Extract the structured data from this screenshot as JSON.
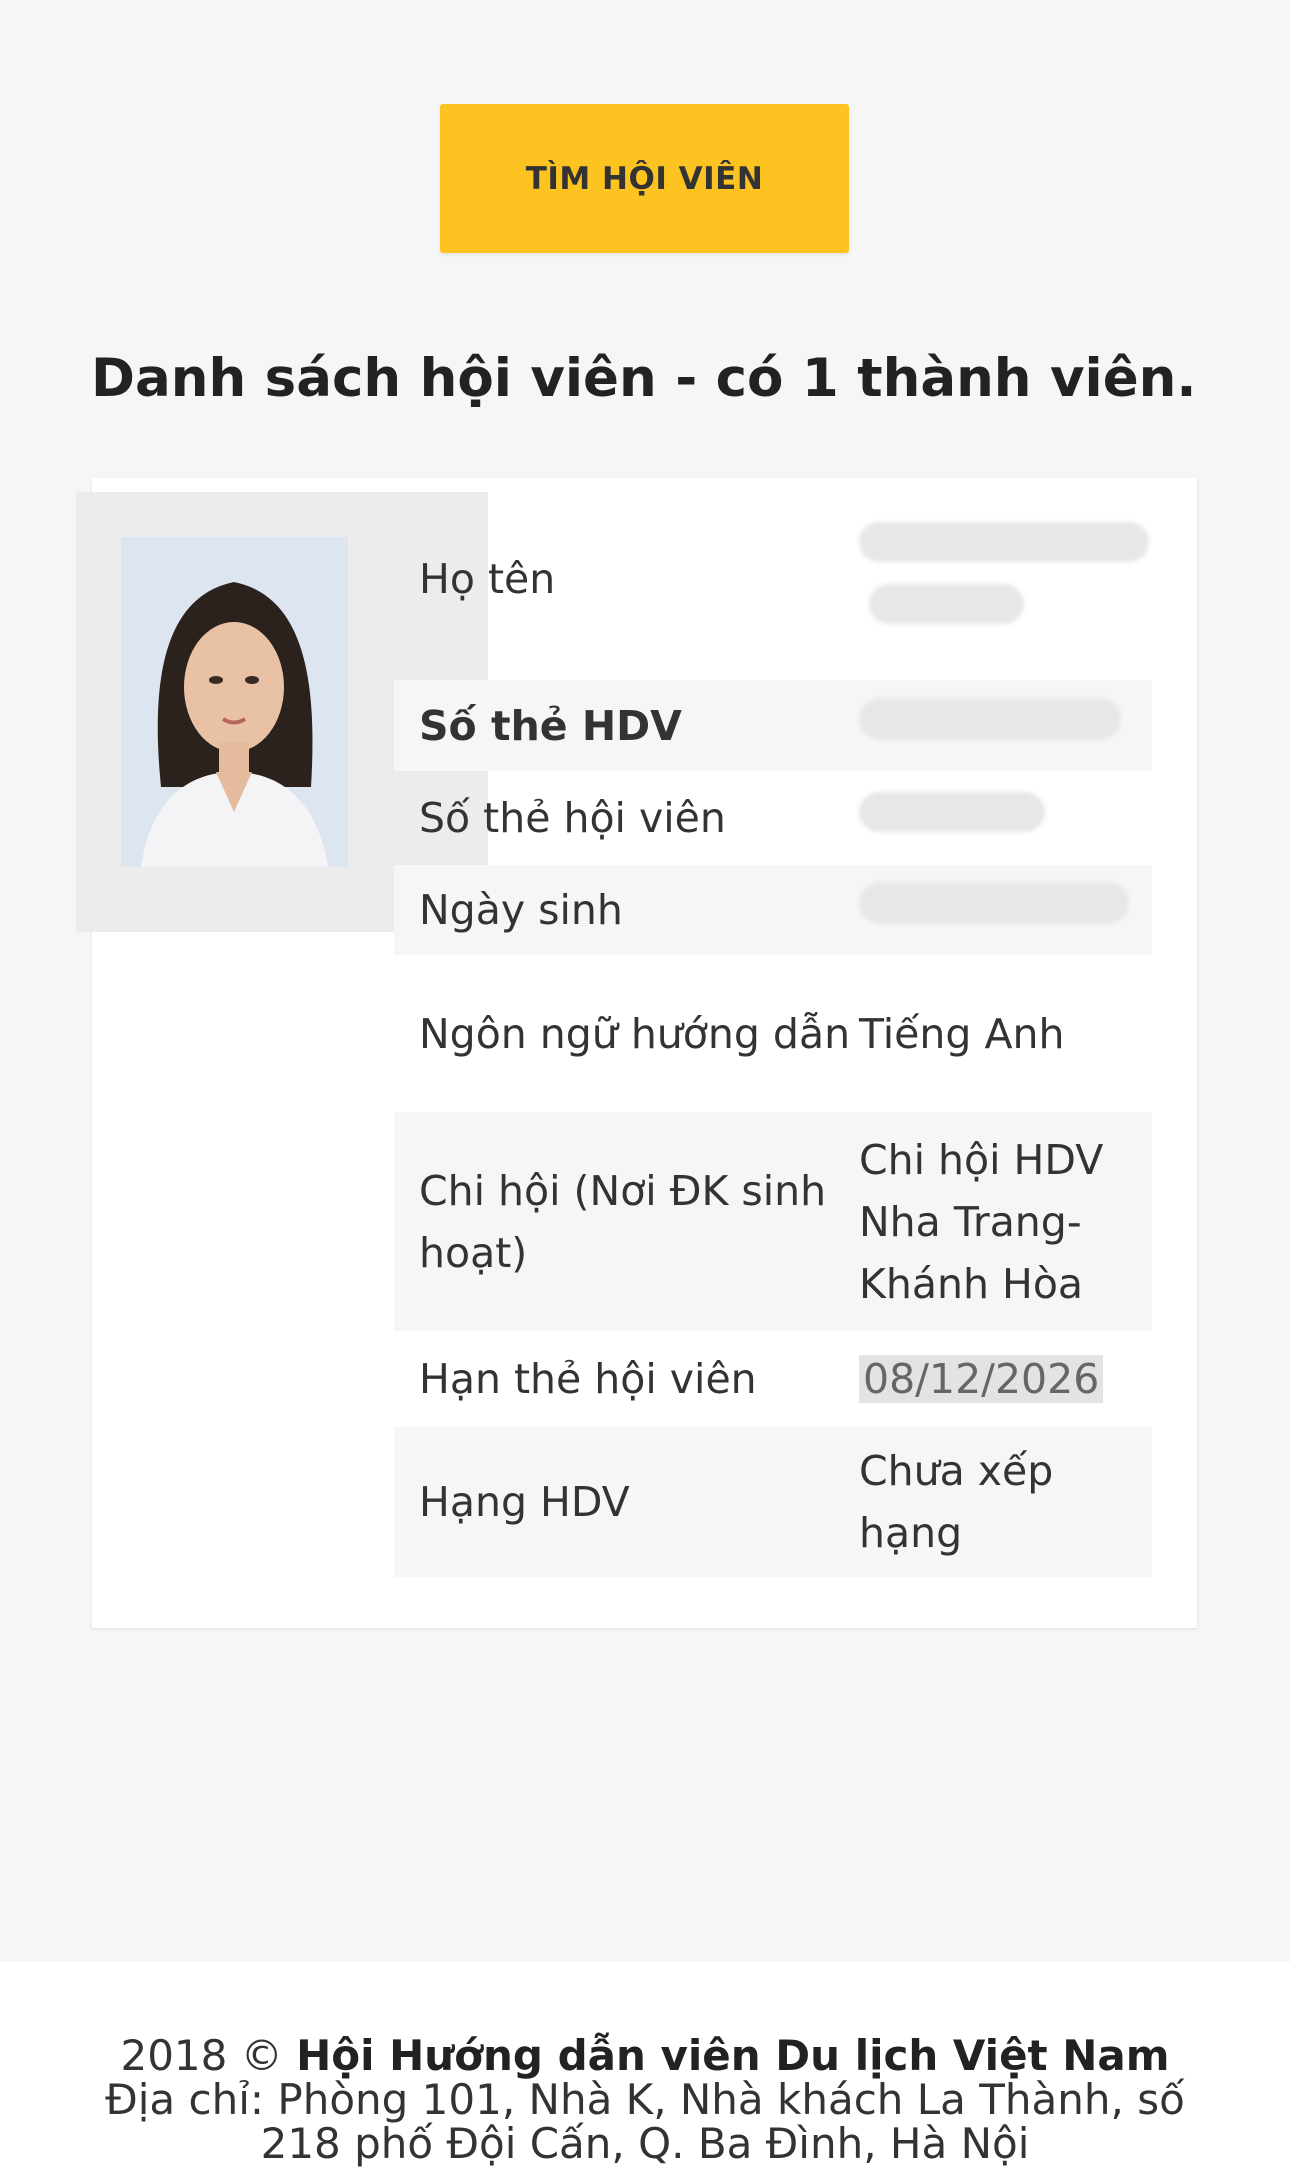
{
  "search_button_label": "TÌM HỘI VIÊN",
  "list_title": "Danh sách hội viên - có 1 thành viên.",
  "member": {
    "photo_icon": "member-photo",
    "fields": [
      {
        "label": "Họ tên",
        "value": ""
      },
      {
        "label": "Số thẻ HDV",
        "value": ""
      },
      {
        "label": "Số thẻ hội viên",
        "value": ""
      },
      {
        "label": "Ngày sinh",
        "value": ""
      },
      {
        "label": "Ngôn ngữ hướng dẫn",
        "value": "Tiếng Anh"
      },
      {
        "label": "Chi hội (Nơi ĐK sinh hoạt)",
        "value": "Chi hội HDV Nha Trang-Khánh Hòa"
      },
      {
        "label": "Hạn thẻ hội viên",
        "value": "08/12/2026"
      },
      {
        "label": "Hạng HDV",
        "value": "Chưa xếp hạng"
      }
    ]
  },
  "footer": {
    "year": "2018 ©",
    "org_name": "Hội Hướng dẫn viên Du lịch Việt Nam",
    "address": "Địa chỉ: Phòng 101, Nhà K, Nhà khách La Thành, số 218 phố Đội Cấn, Q. Ba Đình, Hà Nội"
  },
  "colors": {
    "accent": "#fdc321",
    "background": "#f6f6f6"
  }
}
